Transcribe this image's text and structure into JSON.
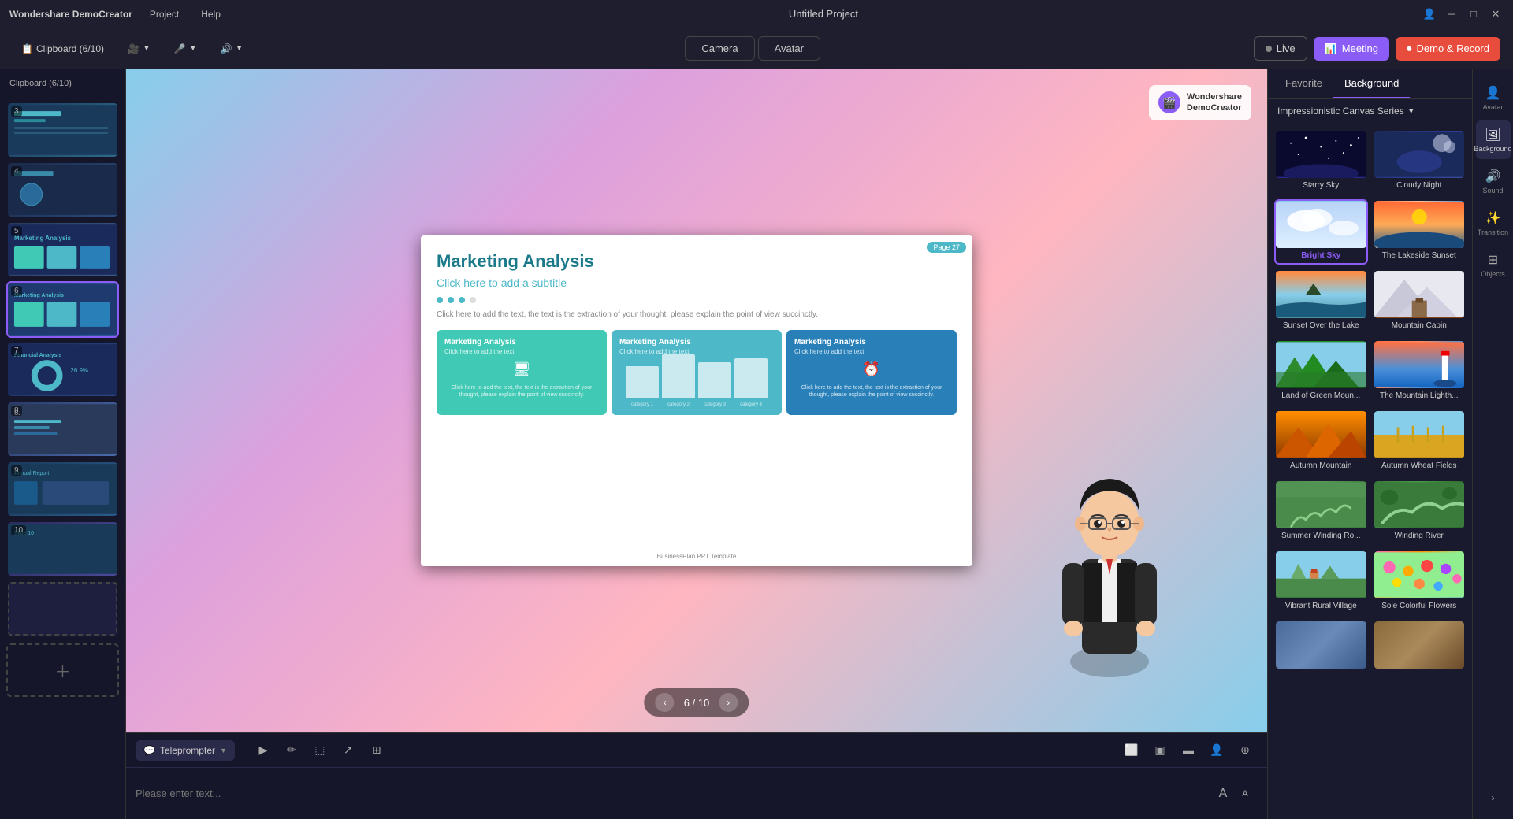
{
  "app": {
    "name": "Wondershare DemoCreator",
    "title": "Untitled Project"
  },
  "title_bar": {
    "menus": [
      "Project",
      "Help"
    ],
    "controls": [
      "user-icon",
      "minimize",
      "maximize",
      "close"
    ]
  },
  "toolbar": {
    "clipboard_label": "Clipboard (6/10)",
    "camera_label": "Camera",
    "avatar_label": "Avatar",
    "live_label": "Live",
    "meeting_label": "Meeting",
    "demo_label": "Demo & Record"
  },
  "slides": [
    {
      "num": 3,
      "active": false
    },
    {
      "num": 4,
      "active": false
    },
    {
      "num": 5,
      "active": false
    },
    {
      "num": 6,
      "active": true
    },
    {
      "num": 7,
      "active": false
    },
    {
      "num": 8,
      "active": false
    },
    {
      "num": 9,
      "active": false
    },
    {
      "num": 10,
      "active": false
    }
  ],
  "canvas": {
    "page_label": "Page",
    "page_num": "27",
    "slide_title": "Marketing Analysis",
    "slide_subtitle": "Click here to add a subtitle",
    "slide_text": "Click here to add the text, the text is the extraction of your thought, please explain the point of view succinctly.",
    "card1_title": "Marketing Analysis",
    "card1_sub": "Click here to add the text",
    "card1_icon": "🖥",
    "card1_text": "Click here to add the text, the text is the extraction of your thought, please explain the point of view succinctly.",
    "card2_title": "Marketing Analysis",
    "card2_sub": "Click here to add the text",
    "bar_labels": [
      "category 1",
      "category 2",
      "category 3",
      "category 4"
    ],
    "card3_title": "Marketing Analysis",
    "card3_sub": "Click here to add the text",
    "card3_icon": "⏰",
    "card3_text": "Click here to add the text, the text is the extraction of your thought, please explain the point of view succinctly.",
    "footer_text": "BusinessPlan PPT Template",
    "logo_line1": "Wondershare",
    "logo_line2": "DemoCreator",
    "page_nav_current": "6",
    "page_nav_total": "10"
  },
  "bottom": {
    "teleprompter_label": "Teleprompter",
    "input_placeholder": "Please enter text...",
    "icons": [
      "play",
      "pen",
      "square",
      "chat",
      "grid"
    ]
  },
  "right_panel": {
    "favorite_tab": "Favorite",
    "background_tab": "Background",
    "series_label": "Impressionistic Canvas Series",
    "backgrounds": [
      {
        "id": "starry-sky",
        "label": "Starry Sky",
        "thumb_class": "bg-starry",
        "selected": false,
        "highlight": false
      },
      {
        "id": "cloudy-night",
        "label": "Cloudy Night",
        "thumb_class": "bg-cloudy",
        "selected": false,
        "highlight": false
      },
      {
        "id": "bright-sky",
        "label": "Bright Sky",
        "thumb_class": "bg-bright-sky",
        "selected": true,
        "highlight": true
      },
      {
        "id": "lakeside-sunset",
        "label": "The Lakeside Sunset",
        "thumb_class": "bg-lakeside",
        "selected": false,
        "highlight": false
      },
      {
        "id": "sunset-lake",
        "label": "Sunset Over the Lake",
        "thumb_class": "bg-sunset-lake",
        "selected": false,
        "highlight": false
      },
      {
        "id": "mountain-cabin",
        "label": "Mountain Cabin",
        "thumb_class": "bg-mountain",
        "selected": false,
        "highlight": false
      },
      {
        "id": "green-mountain",
        "label": "Land of Green Moun...",
        "thumb_class": "bg-green-mount",
        "selected": false,
        "highlight": false
      },
      {
        "id": "lighthouse",
        "label": "The Mountain Lighth...",
        "thumb_class": "bg-lighthouse",
        "selected": false,
        "highlight": false
      },
      {
        "id": "autumn-mountain",
        "label": "Autumn Mountain",
        "thumb_class": "bg-autumn-mount",
        "selected": false,
        "highlight": false
      },
      {
        "id": "autumn-wheat",
        "label": "Autumn Wheat Fields",
        "thumb_class": "bg-wheat",
        "selected": false,
        "highlight": false
      },
      {
        "id": "summer-winding",
        "label": "Summer Winding Ro...",
        "thumb_class": "bg-summer-winding",
        "selected": false,
        "highlight": false
      },
      {
        "id": "winding-river",
        "label": "Winding River",
        "thumb_class": "bg-winding",
        "selected": false,
        "highlight": false
      },
      {
        "id": "rural-village",
        "label": "Vibrant Rural Village",
        "thumb_class": "bg-rural",
        "selected": false,
        "highlight": false
      },
      {
        "id": "sole-flowers",
        "label": "Sole Colorful Flowers",
        "thumb_class": "bg-flowers",
        "selected": false,
        "highlight": false
      }
    ]
  },
  "side_icons": [
    {
      "icon": "👤",
      "label": "Avatar",
      "name": "avatar-icon"
    },
    {
      "icon": "🖼",
      "label": "Background",
      "name": "background-icon",
      "active": true
    },
    {
      "icon": "🔊",
      "label": "Sound",
      "name": "sound-icon"
    },
    {
      "icon": "✨",
      "label": "Transition",
      "name": "transition-icon"
    },
    {
      "icon": "⊞",
      "label": "Objects",
      "name": "objects-icon"
    }
  ],
  "font_size_controls": {
    "increase": "A",
    "decrease": "A"
  }
}
